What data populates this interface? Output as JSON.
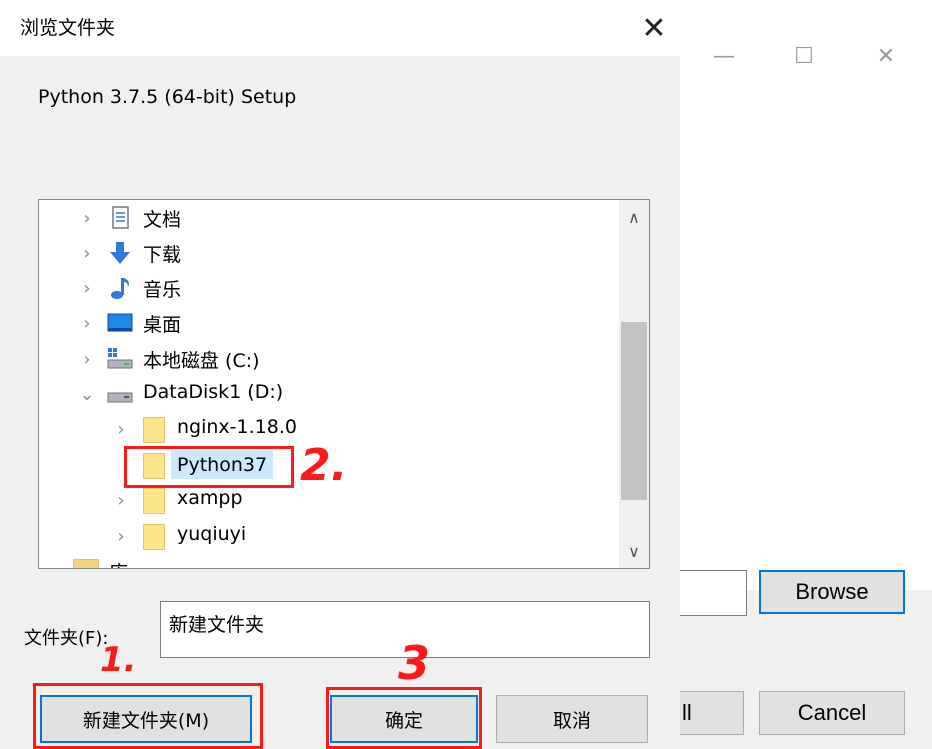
{
  "dialog": {
    "title": "浏览文件夹",
    "description": "Python 3.7.5 (64-bit) Setup",
    "close_glyph": "✕",
    "tree": {
      "items": [
        {
          "label": "文档",
          "icon": "document-icon",
          "expanded": false,
          "indent": 0
        },
        {
          "label": "下载",
          "icon": "download-arrow-icon",
          "expanded": false,
          "indent": 0
        },
        {
          "label": "音乐",
          "icon": "music-note-icon",
          "expanded": false,
          "indent": 0
        },
        {
          "label": "桌面",
          "icon": "desktop-icon",
          "expanded": false,
          "indent": 0
        },
        {
          "label": "本地磁盘 (C:)",
          "icon": "system-drive-icon",
          "expanded": false,
          "indent": 0
        },
        {
          "label": "DataDisk1 (D:)",
          "icon": "drive-icon",
          "expanded": true,
          "indent": 0
        },
        {
          "label": "nginx-1.18.0",
          "icon": "folder-icon",
          "expanded": false,
          "indent": 1
        },
        {
          "label": "Python37",
          "icon": "folder-icon",
          "expanded": false,
          "indent": 1,
          "selected": true
        },
        {
          "label": "xampp",
          "icon": "folder-icon",
          "expanded": false,
          "indent": 1
        },
        {
          "label": "yuqiuyi",
          "icon": "folder-icon",
          "expanded": false,
          "indent": 1
        },
        {
          "label": "库",
          "icon": "library-icon",
          "expanded": false,
          "indent": 0
        }
      ]
    },
    "folder_field": {
      "label": "文件夹(F):",
      "value": "新建文件夹"
    },
    "buttons": {
      "new_folder": "新建文件夹(M)",
      "ok": "确定",
      "cancel": "取消"
    }
  },
  "background_window": {
    "minimize_glyph": "—",
    "maximize_glyph": "☐",
    "close_glyph": "✕",
    "browse_label": "Browse",
    "install_label_partial": "ll",
    "cancel_label": "Cancel"
  },
  "annotations": {
    "mark_1": "1.",
    "mark_2": "2.",
    "mark_3": "3",
    "color": "#ff1a1a"
  },
  "colors": {
    "accent_border": "#0078d7",
    "selection": "#cce8ff",
    "folder": "#fde68a"
  }
}
